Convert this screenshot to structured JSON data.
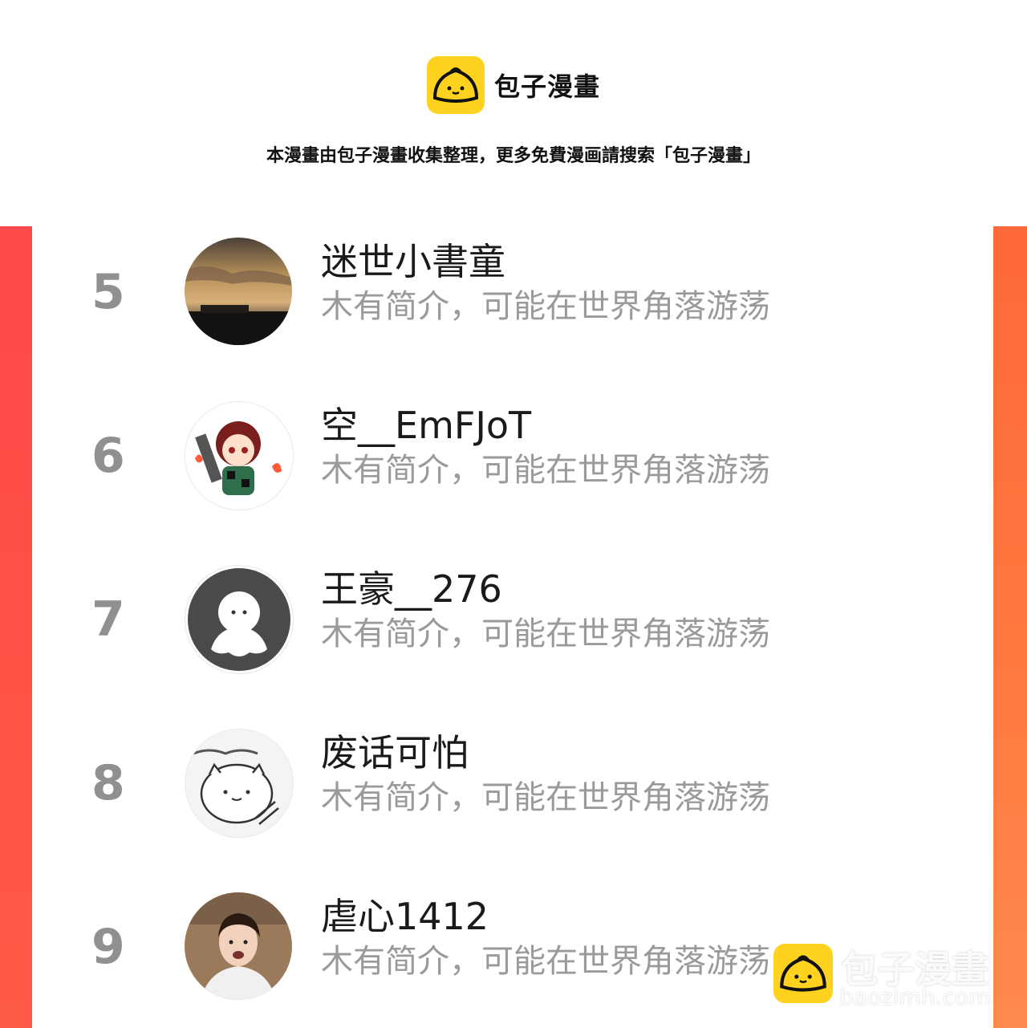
{
  "header": {
    "brand_name": "包子漫畫",
    "notice": "本漫畫由包子漫畫收集整理，更多免費漫画請搜索「包子漫畫」"
  },
  "colors": {
    "logo_yellow": "#ffd21f",
    "accent_left": "#ff4a4a",
    "accent_right": "#ff7a40",
    "rank_gray": "#909090",
    "bio_gray": "#9a9a9a"
  },
  "users": [
    {
      "rank": "5",
      "name": "迷世小書童",
      "bio": "木有简介，可能在世界角落游荡",
      "avatar": "sunset-photo-avatar"
    },
    {
      "rank": "6",
      "name": "空__EmFJoT",
      "bio": "木有简介，可能在世界角落游荡",
      "avatar": "anime-character-avatar"
    },
    {
      "rank": "7",
      "name": "王豪__276",
      "bio": "木有简介，可能在世界角落游荡",
      "avatar": "default-ghost-avatar"
    },
    {
      "rank": "8",
      "name": "废话可怕",
      "bio": "木有简介，可能在世界角落游荡",
      "avatar": "cartoon-cat-avatar"
    },
    {
      "rank": "9",
      "name": "虐心1412",
      "bio": "木有简介，可能在世界角落游荡",
      "avatar": "person-photo-avatar"
    }
  ],
  "watermark": {
    "name": "包子漫畫",
    "url": "baozimh.com"
  }
}
